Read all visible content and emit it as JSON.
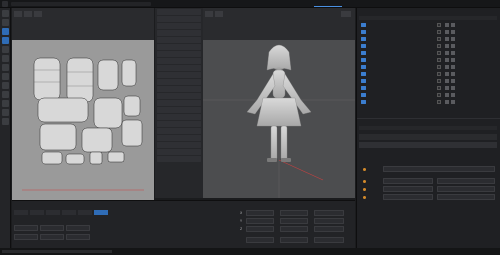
{
  "top_tabs": [
    "",
    "",
    "",
    "",
    "",
    "",
    "",
    "",
    ""
  ],
  "active_tab_index": 3,
  "uv_panel_title": "",
  "viewport_title": "",
  "viewport_footer_left": "",
  "viewport_footer_right": "",
  "object_manager_title": "",
  "objects": [
    {
      "label": ""
    },
    {
      "label": ""
    },
    {
      "label": ""
    },
    {
      "label": ""
    },
    {
      "label": ""
    },
    {
      "label": ""
    },
    {
      "label": ""
    },
    {
      "label": ""
    },
    {
      "label": ""
    },
    {
      "label": ""
    },
    {
      "label": ""
    },
    {
      "label": ""
    }
  ],
  "coords_title": "",
  "coords": {
    "rows": [
      {
        "axis": "X",
        "pos": "",
        "rot": "",
        "scale": ""
      },
      {
        "axis": "Y",
        "pos": "",
        "rot": "",
        "scale": ""
      },
      {
        "axis": "Z",
        "pos": "",
        "rot": "",
        "scale": ""
      }
    ]
  },
  "attributes_title": "",
  "attributes_field": "",
  "colors": {
    "accent": "#4a90e2",
    "uv_bg": "#9a9a9a",
    "viewport_bg": "#4c4d4f",
    "object_label": "#9cc27a"
  }
}
